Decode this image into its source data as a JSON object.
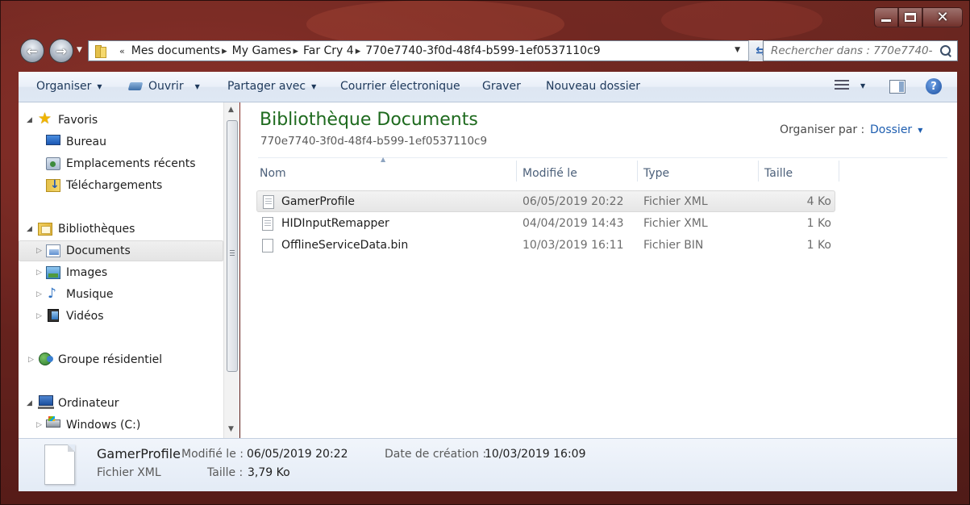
{
  "window": {
    "caption_buttons": {
      "minimize": "minimize-icon",
      "maximize": "maximize-icon",
      "close": "close-icon"
    }
  },
  "address": {
    "prefix": "«",
    "crumbs": [
      "Mes documents",
      "My Games",
      "Far Cry 4",
      "770e7740-3f0d-48f4-b599-1ef0537110c9"
    ]
  },
  "search": {
    "placeholder": "Rechercher dans : 770e7740-3..."
  },
  "toolbar": {
    "organize": "Organiser",
    "open": "Ouvrir",
    "share": "Partager avec",
    "email": "Courrier électronique",
    "burn": "Graver",
    "new_folder": "Nouveau dossier",
    "help": "?"
  },
  "nav": {
    "favorites": "Favoris",
    "desktop": "Bureau",
    "recent": "Emplacements récents",
    "downloads": "Téléchargements",
    "libraries": "Bibliothèques",
    "documents": "Documents",
    "images": "Images",
    "music": "Musique",
    "videos": "Vidéos",
    "homegroup": "Groupe résidentiel",
    "computer": "Ordinateur",
    "drive_c": "Windows (C:)"
  },
  "library": {
    "title": "Bibliothèque Documents",
    "subtitle": "770e7740-3f0d-48f4-b599-1ef0537110c9",
    "arrange_label": "Organiser par :",
    "arrange_value": "Dossier"
  },
  "columns": {
    "name": "Nom",
    "modified": "Modifié le",
    "type": "Type",
    "size": "Taille"
  },
  "files": [
    {
      "name": "GamerProfile",
      "modified": "06/05/2019 20:22",
      "type": "Fichier XML",
      "size": "4 Ko"
    },
    {
      "name": "HIDInputRemapper",
      "modified": "04/04/2019 14:43",
      "type": "Fichier XML",
      "size": "1 Ko"
    },
    {
      "name": "OfflineServiceData.bin",
      "modified": "10/03/2019 16:11",
      "type": "Fichier BIN",
      "size": "1 Ko"
    }
  ],
  "details": {
    "name": "GamerProfile",
    "type": "Fichier XML",
    "modified_label": "Modifié le :",
    "modified_value": "06/05/2019 20:22",
    "size_label": "Taille :",
    "size_value": "3,79 Ko",
    "created_label": "Date de création :",
    "created_value": "10/03/2019 16:09"
  }
}
